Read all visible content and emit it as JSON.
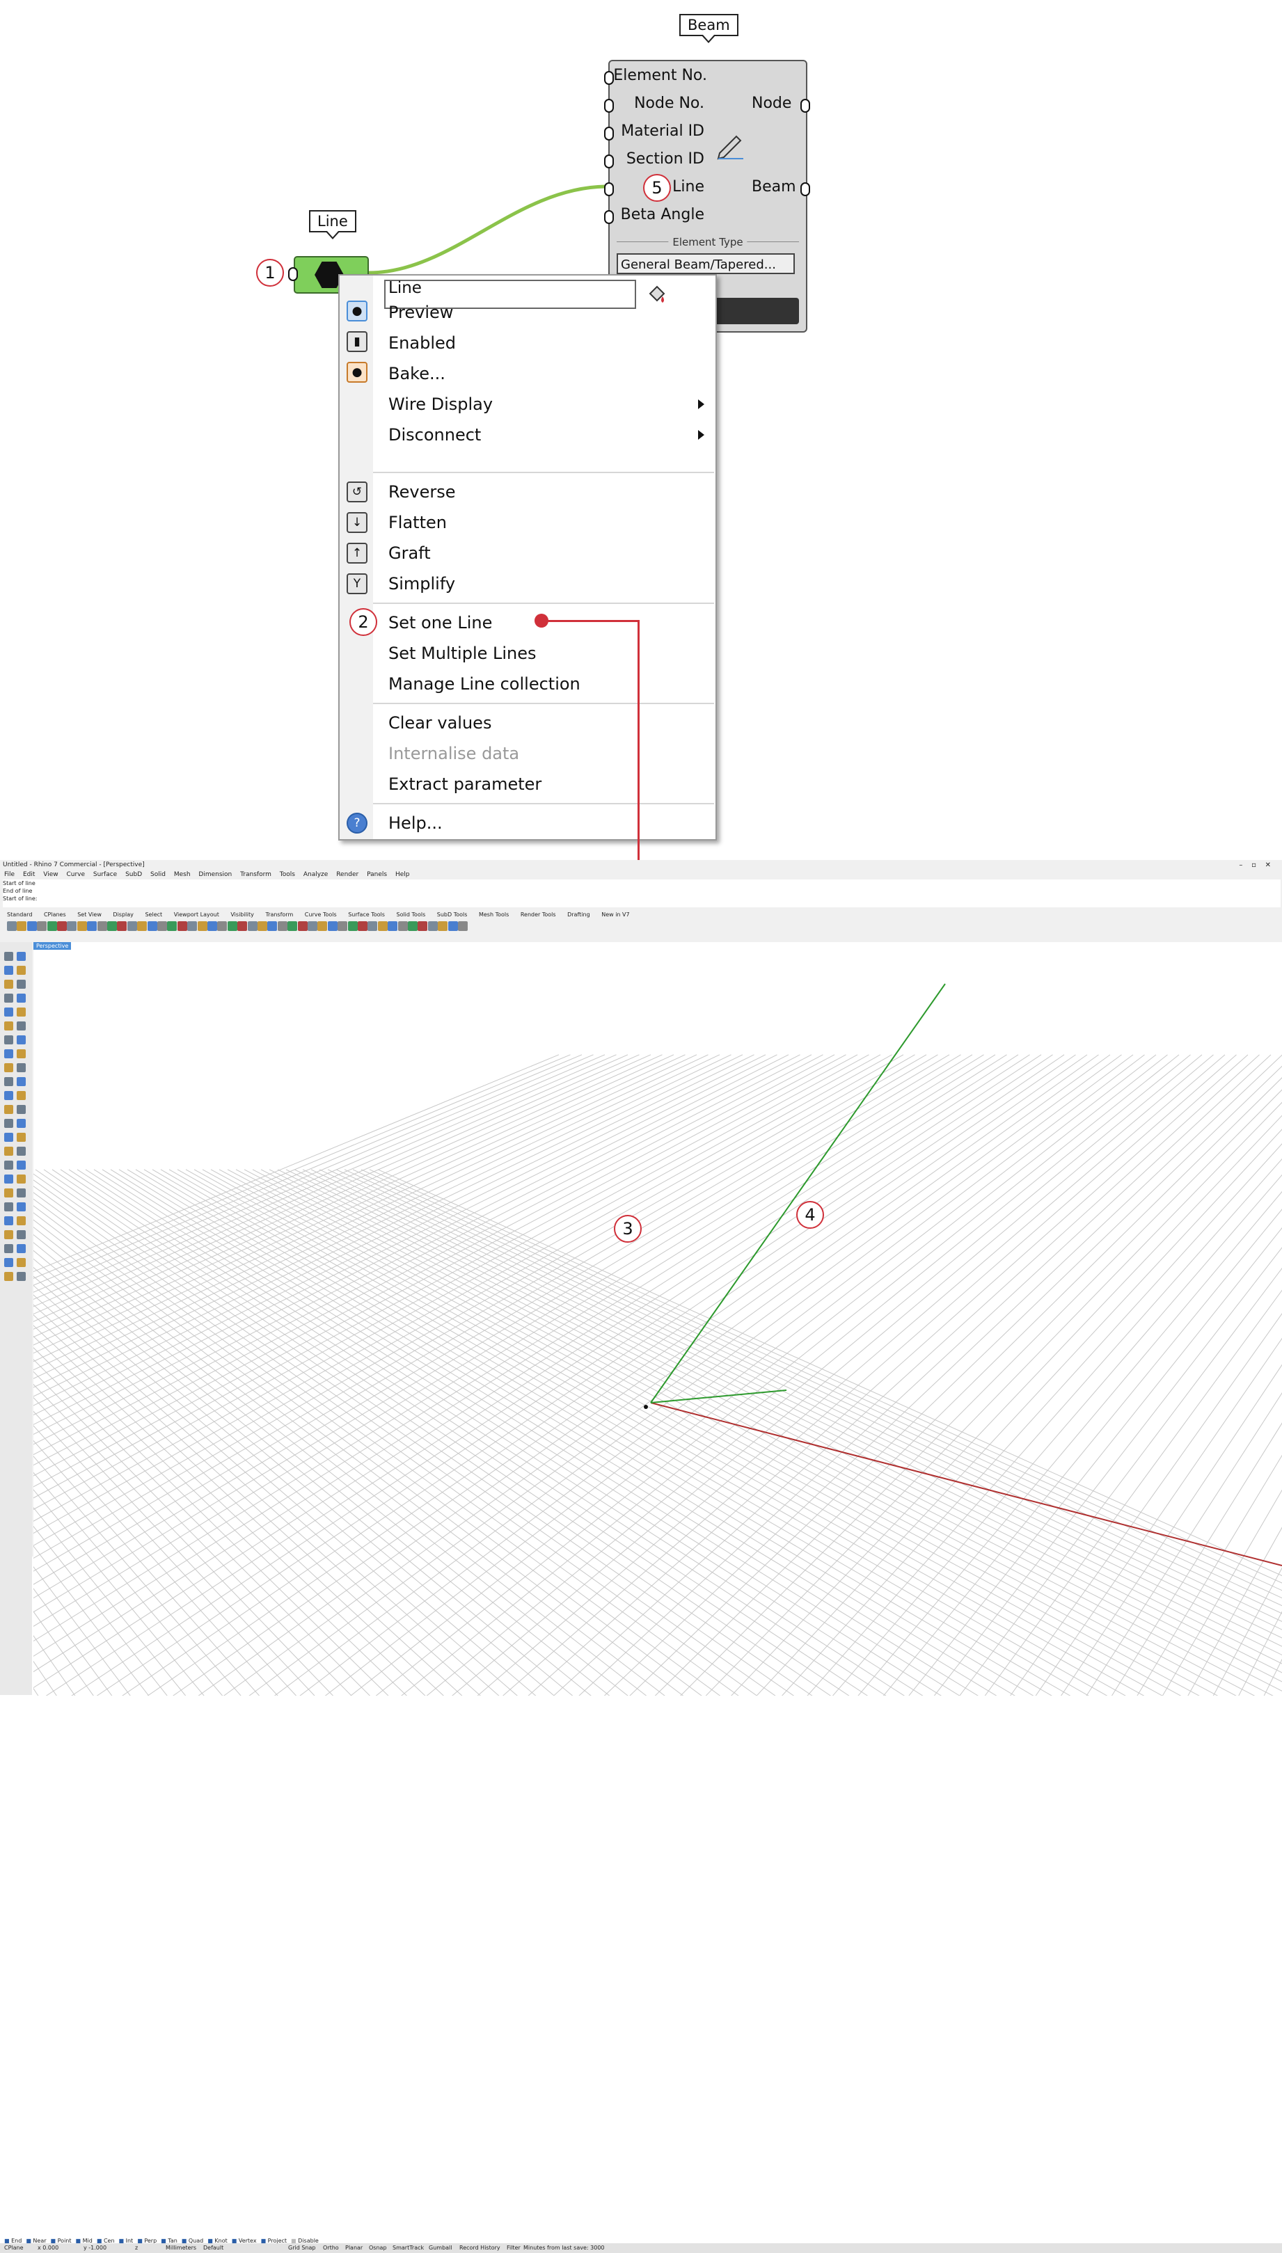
{
  "beam_component": {
    "tag": "Beam",
    "inputs": [
      "Element No.",
      "Node No.",
      "Material ID",
      "Section ID",
      "Line",
      "Beta Angle"
    ],
    "outputs": [
      "Node",
      "Beam"
    ],
    "element_type_label": "Element Type",
    "element_type_value": "General  Beam/Tapered..."
  },
  "line_component": {
    "tag": "Line"
  },
  "context_menu": {
    "name_value": "Line",
    "items": {
      "preview": "Preview",
      "enabled": "Enabled",
      "bake": "Bake...",
      "wire_display": "Wire Display",
      "disconnect": "Disconnect",
      "reverse": "Reverse",
      "flatten": "Flatten",
      "graft": "Graft",
      "simplify": "Simplify",
      "set_one": "Set one Line",
      "set_multiple": "Set Multiple Lines",
      "manage": "Manage Line collection",
      "clear": "Clear values",
      "internalise": "Internalise data",
      "extract": "Extract parameter",
      "help": "Help..."
    }
  },
  "annotations": [
    "1",
    "2",
    "3",
    "4",
    "5"
  ],
  "rhino": {
    "title": "Untitled - Rhino 7 Commercial - [Perspective]",
    "menu": [
      "File",
      "Edit",
      "View",
      "Curve",
      "Surface",
      "SubD",
      "Solid",
      "Mesh",
      "Dimension",
      "Transform",
      "Tools",
      "Analyze",
      "Render",
      "Panels",
      "Help"
    ],
    "command_history": [
      "Start of line",
      "End of line"
    ],
    "command_prompt": "Start of line:",
    "toolbar_tabs": [
      "Standard",
      "CPlanes",
      "Set View",
      "Display",
      "Select",
      "Viewport Layout",
      "Visibility",
      "Transform",
      "Curve Tools",
      "Surface Tools",
      "Solid Tools",
      "SubD Tools",
      "Mesh Tools",
      "Render Tools",
      "Drafting",
      "New in V7"
    ],
    "viewport_label": "Perspective",
    "osnaps": [
      "End",
      "Near",
      "Point",
      "Mid",
      "Cen",
      "Int",
      "Perp",
      "Tan",
      "Quad",
      "Knot",
      "Vertex",
      "Project",
      "Disable"
    ],
    "status": {
      "cplane": "CPlane",
      "x": "x 0.000",
      "y": "y -1.000",
      "z": "z",
      "units": "Millimeters",
      "layer": "Default",
      "toggles": [
        "Grid Snap",
        "Ortho",
        "Planar",
        "Osnap",
        "SmartTrack",
        "Gumball",
        "Record History",
        "Filter"
      ],
      "save": "Minutes from last save: 3000"
    }
  },
  "colors": {
    "annotation": "#d0303a",
    "wire": "#8bc34a",
    "grid": "#c8c8c8",
    "x_axis": "#b03030",
    "y_axis": "#2d9a2d"
  }
}
